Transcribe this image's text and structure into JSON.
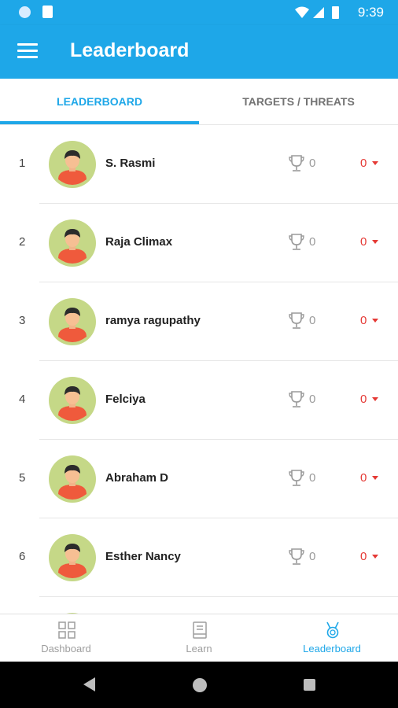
{
  "status_bar": {
    "time": "9:39"
  },
  "app_bar": {
    "title": "Leaderboard"
  },
  "tabs": [
    {
      "label": "LEADERBOARD",
      "active": true
    },
    {
      "label": "TARGETS / THREATS",
      "active": false
    }
  ],
  "leaderboard": [
    {
      "rank": "1",
      "name": "S. Rasmi",
      "trophies": "0",
      "score": "0"
    },
    {
      "rank": "2",
      "name": "Raja Climax",
      "trophies": "0",
      "score": "0"
    },
    {
      "rank": "3",
      "name": "ramya ragupathy",
      "trophies": "0",
      "score": "0"
    },
    {
      "rank": "4",
      "name": "Felciya",
      "trophies": "0",
      "score": "0"
    },
    {
      "rank": "5",
      "name": "Abraham D",
      "trophies": "0",
      "score": "0"
    },
    {
      "rank": "6",
      "name": "Esther Nancy",
      "trophies": "0",
      "score": "0"
    }
  ],
  "bottom_nav": [
    {
      "label": "Dashboard",
      "icon": "grid-icon",
      "active": false
    },
    {
      "label": "Learn",
      "icon": "book-icon",
      "active": false
    },
    {
      "label": "Leaderboard",
      "icon": "medal-icon",
      "active": true
    }
  ],
  "colors": {
    "primary": "#1ea7e8",
    "negative": "#e53935",
    "avatar_bg": "#c5d887"
  }
}
